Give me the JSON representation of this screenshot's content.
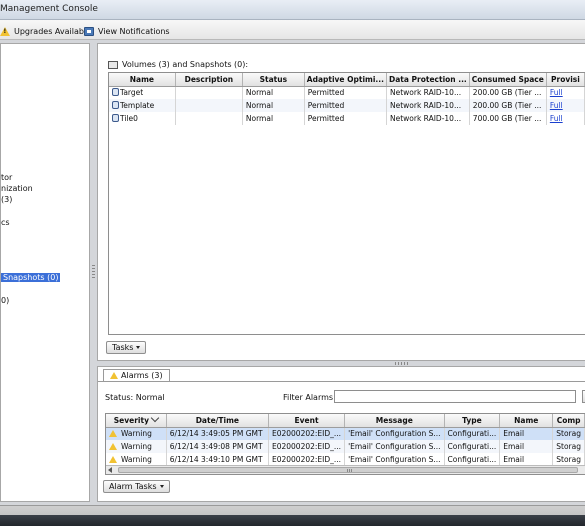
{
  "window": {
    "title": "Management Console"
  },
  "toolbar": {
    "upgrades_label": "Upgrades Available",
    "notifications_label": "View Notifications"
  },
  "nav": {
    "items": [
      {
        "label": "tor",
        "selected": false
      },
      {
        "label": "nization",
        "selected": false
      },
      {
        "label": "(3)",
        "selected": false
      },
      {
        "label": "cs",
        "selected": false
      },
      {
        "label": "Snapshots (0)",
        "selected": true
      },
      {
        "label": "0)",
        "selected": false
      }
    ]
  },
  "volumes": {
    "header": "Volumes (3) and Snapshots (0):",
    "columns": [
      "Name",
      "Description",
      "Status",
      "Adaptive Optimi...",
      "Data Protection ...",
      "Consumed Space",
      "Provisi"
    ],
    "rows": [
      {
        "name": "Target",
        "description": "",
        "status": "Normal",
        "adaptive": "Permitted",
        "protection": "Network RAID-10...",
        "consumed": "200.00 GB (Tier ...",
        "provisioning": "Full"
      },
      {
        "name": "Template",
        "description": "",
        "status": "Normal",
        "adaptive": "Permitted",
        "protection": "Network RAID-10...",
        "consumed": "200.00 GB (Tier ...",
        "provisioning": "Full"
      },
      {
        "name": "Tile0",
        "description": "",
        "status": "Normal",
        "adaptive": "Permitted",
        "protection": "Network RAID-10...",
        "consumed": "700.00 GB (Tier ...",
        "provisioning": "Full"
      }
    ],
    "tasks_label": "Tasks"
  },
  "alarms": {
    "tab_label": "Alarms (3)",
    "status_text": "Status:  Normal",
    "filter_label": "Filter Alarms:",
    "filter_value": "",
    "columns": [
      "Severity",
      "Date/Time",
      "Event",
      "Message",
      "Type",
      "Name",
      "Comp"
    ],
    "rows": [
      {
        "severity": "Warning",
        "datetime": "6/12/14 3:49:05 PM GMT",
        "event": "E02000202:EID_...",
        "message": "'Email' Configuration S...",
        "type": "Configurati...",
        "name": "Email",
        "comp": "Storag"
      },
      {
        "severity": "Warning",
        "datetime": "6/12/14 3:49:08 PM GMT",
        "event": "E02000202:EID_...",
        "message": "'Email' Configuration S...",
        "type": "Configurati...",
        "name": "Email",
        "comp": "Storag"
      },
      {
        "severity": "Warning",
        "datetime": "6/12/14 3:49:10 PM GMT",
        "event": "E02000202:EID_...",
        "message": "'Email' Configuration S...",
        "type": "Configurati...",
        "name": "Email",
        "comp": "Storag"
      }
    ],
    "tasks_label": "Alarm Tasks"
  },
  "colors": {
    "selection": "#3b6fd8",
    "row_highlight": "#cfe0f7",
    "warning": "#f1c232",
    "link": "#1a3fcf"
  },
  "icons": [
    "warning-icon",
    "notifications-icon",
    "volume-icon",
    "dropdown-caret-icon",
    "sort-chevron-icon"
  ]
}
